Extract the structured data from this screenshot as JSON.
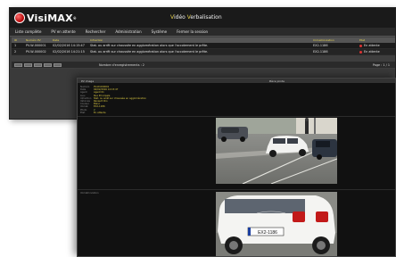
{
  "back_window": {
    "logo": {
      "brand": "VisiMAX",
      "sup": "®",
      "sub": ""
    },
    "title": {
      "first": "V",
      "first_rest": "idéo ",
      "second": "V",
      "second_rest": "erbalisation"
    },
    "header_right": "",
    "menu": [
      "Liste complète",
      "PV en attente",
      "Rechercher",
      "Administration",
      "Système",
      "Fermer la session"
    ],
    "columns": [
      "ID",
      "Numéro PV",
      "Date",
      "Infraction",
      "Immatriculation",
      "Etat"
    ],
    "rows": [
      {
        "id": "1",
        "pv": "PV-W-000001",
        "date": "02/02/2016 14:15:47",
        "infraction": "Stat. ou arrêt sur chaussée en agglomération alors que l'accotement le prête.",
        "immat": "EX2-1186",
        "status": "En attente"
      },
      {
        "id": "2",
        "pv": "PV-W-000002",
        "date": "02/02/2016 14:21:15",
        "infraction": "Stat. ou arrêt sur chaussée en agglomération alors que l'accotement le prête.",
        "immat": "EX2-1186",
        "status": "En attente"
      }
    ],
    "pager": {
      "count_label": "Nombre d'enregistrements : 2",
      "page": "Page : 1 / 1"
    }
  },
  "front_window": {
    "title_left": "PV image",
    "title_right": "Pièce jointe",
    "meta": [
      {
        "label": "Numéro",
        "value": "PV-W-000001",
        "tone": "yellow"
      },
      {
        "label": "Date",
        "value": "02/02/2016 14:15:47",
        "tone": "yellow"
      },
      {
        "label": "Agent",
        "value": "Agent 01",
        "tone": "yellow"
      },
      {
        "label": "Lieu",
        "value": "Rue Principale",
        "tone": "yellow"
      },
      {
        "label": "Infraction",
        "value": "Stat. ou arrêt sur chaussée en agglomération",
        "tone": "yellow"
      },
      {
        "label": "Véhicule",
        "value": "Renault Clio",
        "tone": "yellow"
      },
      {
        "label": "Couleur",
        "value": "Blanc",
        "tone": "yellow"
      },
      {
        "label": "Immat.",
        "value": "EX2-1186",
        "tone": "yellow"
      },
      {
        "label": "Photo",
        "value": "2",
        "tone": "green"
      },
      {
        "label": "Etat",
        "value": "En attente",
        "tone": "yellow"
      }
    ],
    "photo1_label": "",
    "photo2_label": "Immatriculation",
    "plate_text": "EX2-1186"
  },
  "colors": {
    "accent_yellow": "#e8d44d",
    "status_red": "#d33333",
    "dark_bg": "#111111"
  }
}
